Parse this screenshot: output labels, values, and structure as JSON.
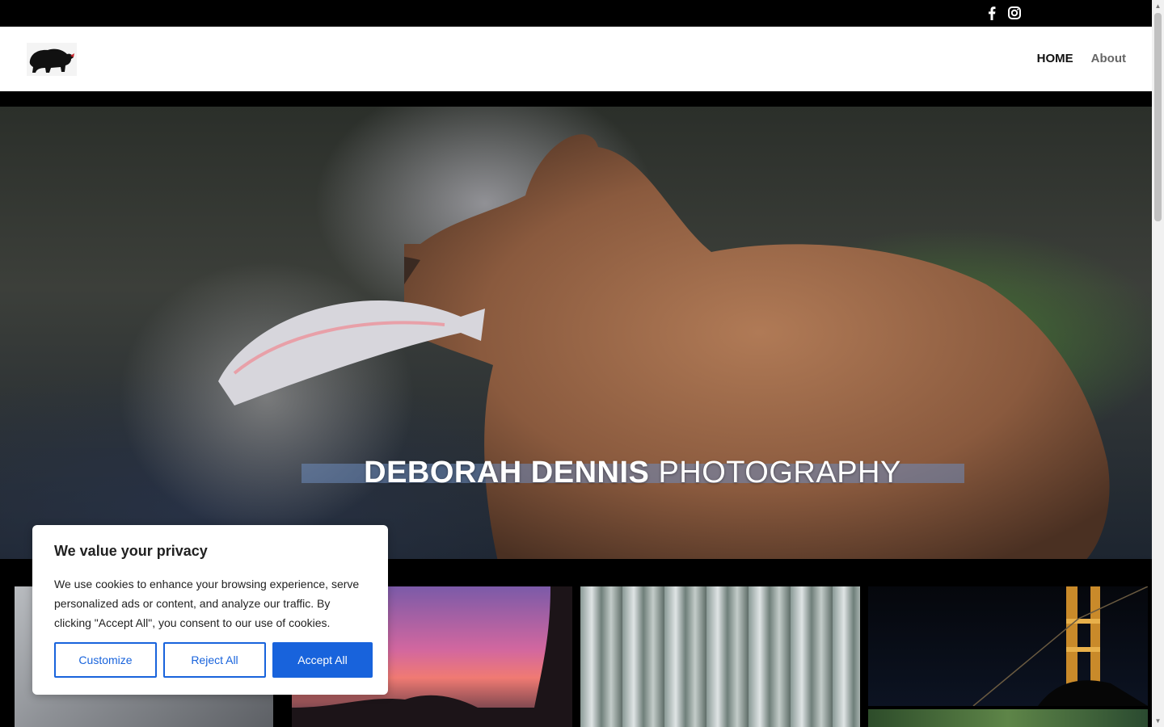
{
  "topbar": {
    "social": [
      {
        "icon": "facebook-icon"
      },
      {
        "icon": "instagram-icon"
      }
    ]
  },
  "header": {
    "nav": {
      "home": "HOME",
      "about": "About"
    }
  },
  "hero": {
    "title_bold": "DEBORAH DENNIS",
    "title_light": "PHOTOGRAPHY"
  },
  "consent": {
    "title": "We value your privacy",
    "body": "We use cookies to enhance your browsing experience, serve personalized ads or content, and analyze our traffic. By clicking \"Accept All\", you consent to our use of cookies.",
    "customize": "Customize",
    "reject": "Reject All",
    "accept": "Accept All"
  },
  "colors": {
    "accent": "#1863dc",
    "topbar": "#000000",
    "header": "#ffffff"
  }
}
